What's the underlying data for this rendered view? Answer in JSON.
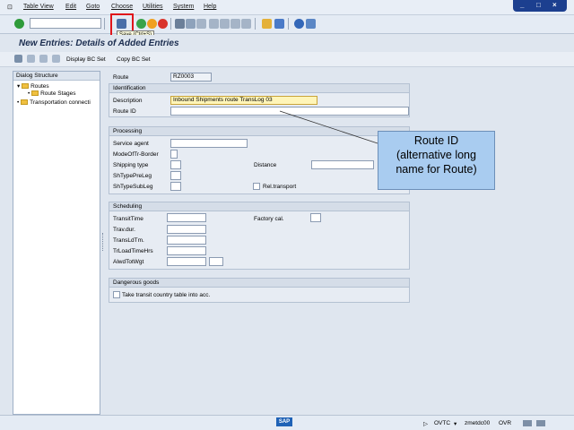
{
  "menu": [
    "Table View",
    "Edit",
    "Goto",
    "Choose",
    "Utilities",
    "System",
    "Help"
  ],
  "window_controls": [
    "_",
    "□",
    "×"
  ],
  "toolbar": {
    "save_tooltip": "Save   (Ctrl+S)"
  },
  "title": "New Entries: Details of Added Entries",
  "app_toolbar": {
    "display_bc_set": "Display BC Set",
    "copy_bc_set": "Copy BC Set"
  },
  "tree": {
    "header": "Dialog Structure",
    "nodes": [
      "Routes",
      "Route Stages",
      "Transportation connecti"
    ]
  },
  "form": {
    "route_label": "Route",
    "route_value": "RZ0003",
    "identification": {
      "header": "Identification",
      "description_label": "Description",
      "description_value": "Inbound Shipments route TransLog 03",
      "route_id_label": "Route ID"
    },
    "processing": {
      "header": "Processing",
      "service_agent": "Service agent",
      "mode_of_tr": "ModeOfTr-Border",
      "shipping_type": "Shipping type",
      "distance": "Distance",
      "sh_type_pre_leg": "ShTypePreLeg",
      "sh_type_sub_leg": "ShTypeSubLeg",
      "rel_transport": "Rel.transport"
    },
    "scheduling": {
      "header": "Scheduling",
      "transit_time": "TransitTime",
      "factory_cal": "Factory cal.",
      "trav_dur": "Trav.dur.",
      "trans_ld_tm": "TransLdTm.",
      "tr_load_time_hrs": "TrLoadTimeHrs",
      "alwd_tot_wgt": "AlwdTotWgt"
    },
    "dangerous_goods": {
      "header": "Dangerous goods",
      "take_transit": "Take transit country table into acc."
    }
  },
  "callout": {
    "line1": "Route ID",
    "line2": "(alternative long",
    "line3": "name for Route)"
  },
  "status": {
    "system": "OVTC",
    "server": "zmetdc00",
    "mode": "OVR"
  },
  "sap_logo": "SAP",
  "colors": {
    "save_highlight": "#e0151b",
    "callout_bg": "#a9ccf0",
    "title": "#1b2d4f"
  }
}
